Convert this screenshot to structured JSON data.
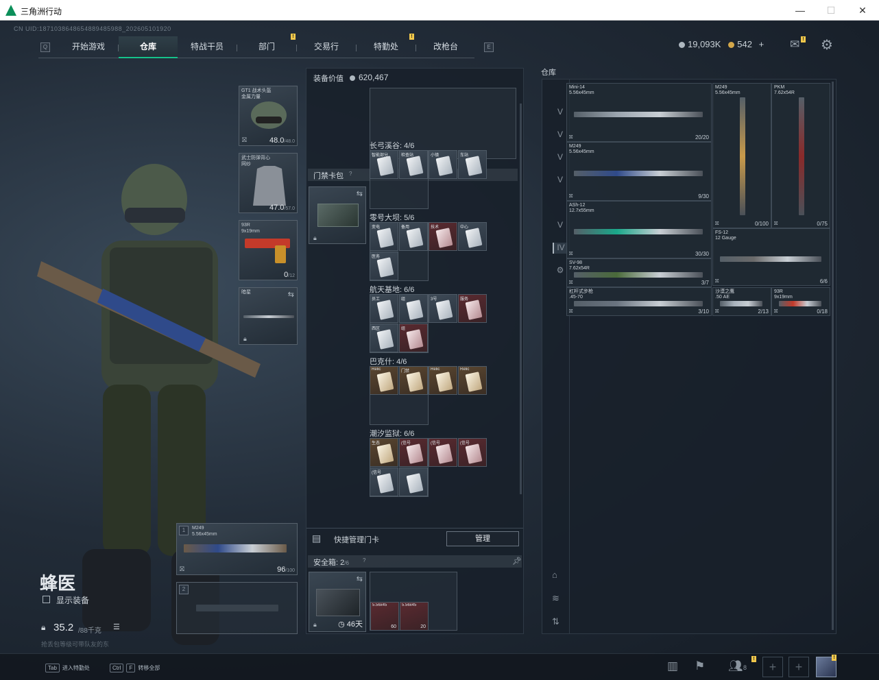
{
  "window": {
    "title": "三角洲行动",
    "min": "—",
    "max": "☐",
    "close": "✕"
  },
  "uid": "CN UID:1871038648654889485988_202605101920",
  "tabs": {
    "q": "Q",
    "e": "E",
    "items": [
      "开始游戏",
      "仓库",
      "特战干员",
      "部门",
      "交易行",
      "特勤处",
      "改枪台"
    ],
    "marks": [
      "!",
      "!"
    ]
  },
  "currency": {
    "silver": "19,093K",
    "gold": "542",
    "add": "+"
  },
  "operator": {
    "name": "蜂医",
    "show_equipment": "显示装备",
    "weight": "35.2",
    "weight_max": "/88千克",
    "weight_note": "抢丢包等级可带队友的东"
  },
  "gear": {
    "helmet": {
      "label": "GT1 战术头盔\n金属力量",
      "dur": "48.0",
      "max": "/48.0"
    },
    "armor": {
      "label": "武士防弹背心\n网纱",
      "dur": "47.0",
      "max": "/57.0"
    },
    "pistol": {
      "label": "93R\n9x19mm",
      "dur": "0",
      "max": "/12"
    },
    "melee": {
      "label": "暗星"
    },
    "primary": {
      "num": "1",
      "label": "M249\n5.56x45mm",
      "dur": "96",
      "max": "/100"
    },
    "secondary": {
      "num": "2"
    }
  },
  "equipment_value": {
    "label": "装备价值",
    "value": "620,467"
  },
  "keycard": {
    "title": "门禁卡包",
    "help": "?",
    "groups": [
      {
        "title": "长弓溪谷: 4/6",
        "cards": [
          {
            "l": "智能部分",
            "c": ""
          },
          {
            "l": "检查站",
            "c": ""
          },
          {
            "l": "小镇",
            "c": ""
          },
          {
            "l": "车站",
            "c": ""
          }
        ]
      },
      {
        "title": "零号大坝: 5/6",
        "cards": [
          {
            "l": "变电",
            "c": ""
          },
          {
            "l": "备用",
            "c": ""
          },
          {
            "l": "技术",
            "c": "red"
          },
          {
            "l": "中心",
            "c": ""
          },
          {
            "l": "医务",
            "c": ""
          }
        ]
      },
      {
        "title": "航天基地: 6/6",
        "cards": [
          {
            "l": "员工",
            "c": ""
          },
          {
            "l": "组",
            "c": ""
          },
          {
            "l": "3号",
            "c": ""
          },
          {
            "l": "服务",
            "c": "red"
          },
          {
            "l": "西区",
            "c": ""
          },
          {
            "l": "组",
            "c": "red"
          }
        ]
      },
      {
        "title": "巴克什: 4/6",
        "cards": [
          {
            "l": "Relic",
            "c": "gold"
          },
          {
            "l": "门禁",
            "c": "gold"
          },
          {
            "l": "Relic",
            "c": "gold"
          },
          {
            "l": "Relic",
            "c": "gold"
          }
        ]
      },
      {
        "title": "潮汐监狱: 6/6",
        "cards": [
          {
            "l": "生态",
            "c": "gold"
          },
          {
            "l": "(信号",
            "c": "red"
          },
          {
            "l": "(信号",
            "c": "red"
          },
          {
            "l": "(信号",
            "c": "red"
          },
          {
            "l": "(信号",
            "c": ""
          },
          {
            "l": "",
            "c": ""
          }
        ]
      }
    ],
    "quick_manage": "快捷管理门卡",
    "manage_btn": "管理"
  },
  "safebox": {
    "title": "安全箱: 2",
    "cap": "/6",
    "help": "?",
    "days": "46天",
    "items": [
      {
        "l": "5.56x45",
        "n": "60"
      },
      {
        "l": "5.56x45",
        "n": "20"
      }
    ]
  },
  "warehouse": {
    "title": "仓库",
    "weapons": [
      {
        "n": "Mini-14\n5.56x45mm",
        "c": "20/20"
      },
      {
        "n": "M249\n5.56x45mm",
        "c": "0/100"
      },
      {
        "n": "PKM\n7.62x54R",
        "c": "0/75"
      },
      {
        "n": "M249\n5.56x45mm",
        "c": "9/30"
      },
      {
        "n": "ASh-12\n12.7x55mm",
        "c": "30/30"
      },
      {
        "n": "FS-12\n12 Gauge",
        "c": "6/6"
      },
      {
        "n": "SV-98\n7.62x54R",
        "c": "3/7"
      },
      {
        "n": "杠杆式步枪\n.45-70",
        "c": "3/10"
      },
      {
        "n": "沙漠之鹰\n.50 AE",
        "c": "2/13"
      },
      {
        "n": "93R\n9x19mm",
        "c": "0/18"
      }
    ],
    "side_icons": [
      "helmet-tab",
      "armor-tab",
      "rig-tab",
      "bag-tab",
      "ammo-tab",
      "mod-tab",
      "misc-tab",
      "weapon-tab",
      "settings-tab"
    ],
    "side_labels": [
      "",
      "V",
      "V",
      "V",
      "V",
      "",
      "V",
      "IV",
      "⚙"
    ]
  },
  "bottom": {
    "tab_key": "Tab",
    "tab_text": "进入特勤处",
    "ctrl_key": "Ctrl",
    "f_key": "F",
    "f_text": "转移全部",
    "friends": "8"
  },
  "colors": {
    "accent": "#16c38a",
    "mark": "#f2c84b"
  }
}
